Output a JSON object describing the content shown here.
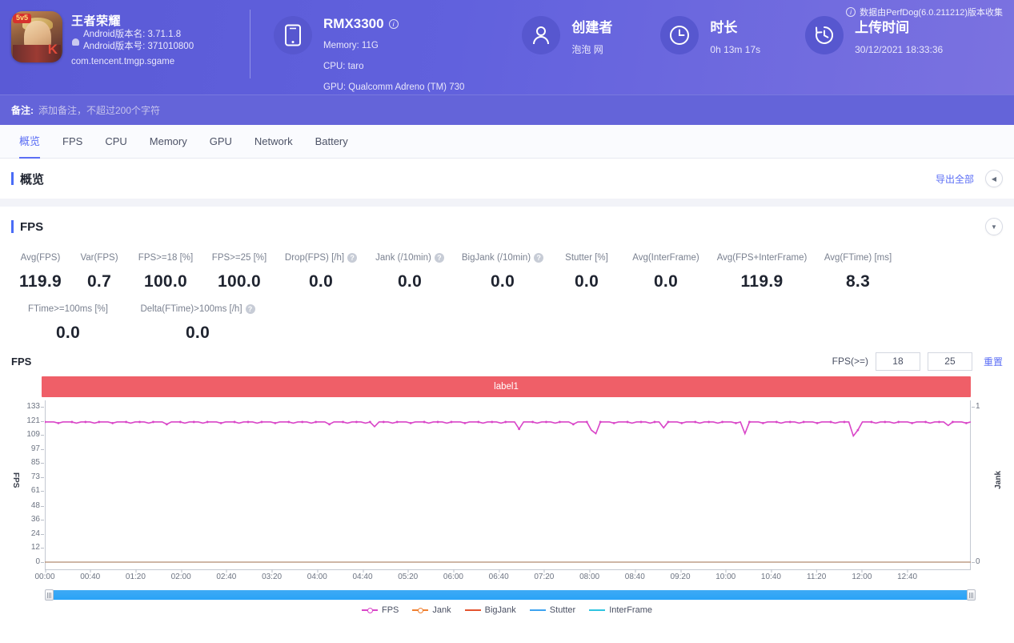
{
  "header": {
    "app": {
      "icon_name": "game-app-icon",
      "badge": "5v5",
      "name": "王者荣耀",
      "version_name_label": "Android版本名: 3.71.1.8",
      "version_code_label": "Android版本号: 371010800",
      "package": "com.tencent.tmgp.sgame"
    },
    "device": {
      "icon_name": "phone-icon",
      "model": "RMX3300",
      "memory": "Memory: 11G",
      "cpu": "CPU: taro",
      "gpu": "GPU: Qualcomm Adreno (TM) 730"
    },
    "creator": {
      "icon_name": "user-icon",
      "title": "创建者",
      "value": "泡泡 网"
    },
    "duration": {
      "icon_name": "clock-icon",
      "title": "时长",
      "value": "0h 13m 17s"
    },
    "upload": {
      "icon_name": "history-icon",
      "title": "上传时间",
      "value": "30/12/2021 18:33:36"
    },
    "perfdog_note": "数据由PerfDog(6.0.211212)版本收集"
  },
  "notebar": {
    "label": "备注:",
    "value": "",
    "placeholder": "添加备注，不超过200个字符"
  },
  "tabs": [
    {
      "label": "概览",
      "active": true
    },
    {
      "label": "FPS",
      "active": false
    },
    {
      "label": "CPU",
      "active": false
    },
    {
      "label": "Memory",
      "active": false
    },
    {
      "label": "GPU",
      "active": false
    },
    {
      "label": "Network",
      "active": false
    },
    {
      "label": "Battery",
      "active": false
    }
  ],
  "overview_panel": {
    "title": "概览",
    "export_label": "导出全部",
    "collapse_icon": "◀"
  },
  "fps_panel": {
    "title": "FPS",
    "expand_icon": "▼",
    "metrics_row1": [
      {
        "label": "Avg(FPS)",
        "value": "119.9",
        "help": false
      },
      {
        "label": "Var(FPS)",
        "value": "0.7",
        "help": false
      },
      {
        "label": "FPS>=18 [%]",
        "value": "100.0",
        "help": false
      },
      {
        "label": "FPS>=25 [%]",
        "value": "100.0",
        "help": false
      },
      {
        "label": "Drop(FPS) [/h]",
        "value": "0.0",
        "help": true
      },
      {
        "label": "Jank (/10min)",
        "value": "0.0",
        "help": true
      },
      {
        "label": "BigJank (/10min)",
        "value": "0.0",
        "help": true
      },
      {
        "label": "Stutter [%]",
        "value": "0.0",
        "help": false
      },
      {
        "label": "Avg(InterFrame)",
        "value": "0.0",
        "help": false
      },
      {
        "label": "Avg(FPS+InterFrame)",
        "value": "119.9",
        "help": false
      },
      {
        "label": "Avg(FTime) [ms]",
        "value": "8.3",
        "help": false
      }
    ],
    "metrics_row2": [
      {
        "label": "FTime>=100ms [%]",
        "value": "0.0",
        "help": false
      },
      {
        "label": "Delta(FTime)>100ms [/h]",
        "value": "0.0",
        "help": true
      }
    ],
    "chart_toolbar": {
      "chart_name": "FPS",
      "threshold_label": "FPS(>=)",
      "threshold_low": "18",
      "threshold_high": "25",
      "reset_label": "重置"
    },
    "label_banner": "label1",
    "label_banner_color": "#ef5f68"
  },
  "chart_data": {
    "type": "line",
    "title": "FPS",
    "xlabel": "",
    "ylabel": "FPS",
    "y2label": "Jank",
    "ylim": [
      0,
      133
    ],
    "y2lim": [
      0,
      1
    ],
    "grid": false,
    "legend_position": "bottom",
    "yticks": [
      133,
      121,
      109,
      97,
      85,
      73,
      61,
      48,
      36,
      24,
      12,
      0
    ],
    "y2ticks": [
      1,
      0
    ],
    "xticks": [
      "00:00",
      "00:40",
      "01:20",
      "02:00",
      "02:40",
      "03:20",
      "04:00",
      "04:40",
      "05:20",
      "06:00",
      "06:40",
      "07:20",
      "08:00",
      "08:40",
      "09:20",
      "10:00",
      "10:40",
      "11:20",
      "12:00",
      "12:40"
    ],
    "series": [
      {
        "name": "FPS",
        "color": "#d946c8",
        "values": [
          120,
          120,
          120,
          119,
          120,
          120,
          120,
          119,
          120,
          120,
          120,
          119,
          120,
          120,
          120,
          119,
          120,
          120,
          120,
          119,
          120,
          120,
          120,
          119,
          120,
          120,
          120,
          118,
          120,
          120,
          120,
          119,
          120,
          120,
          120,
          119,
          120,
          120,
          120,
          119,
          120,
          120,
          120,
          119,
          120,
          120,
          120,
          119,
          120,
          120,
          120,
          119,
          120,
          120,
          120,
          119,
          120,
          120,
          120,
          119,
          120,
          120,
          120,
          118,
          120,
          120,
          120,
          119,
          120,
          120,
          120,
          119,
          120,
          116,
          120,
          120,
          120,
          119,
          120,
          120,
          120,
          119,
          120,
          120,
          120,
          119,
          120,
          120,
          120,
          119,
          120,
          120,
          120,
          119,
          120,
          120,
          120,
          119,
          120,
          120,
          120,
          119,
          120,
          120,
          120,
          114,
          120,
          120,
          120,
          119,
          120,
          120,
          120,
          119,
          120,
          120,
          120,
          118,
          120,
          120,
          120,
          113,
          110,
          120,
          120,
          120,
          119,
          120,
          120,
          120,
          119,
          120,
          120,
          120,
          119,
          120,
          120,
          115,
          120,
          120,
          120,
          119,
          120,
          120,
          120,
          119,
          120,
          120,
          120,
          119,
          120,
          120,
          120,
          119,
          120,
          110,
          120,
          120,
          120,
          119,
          120,
          120,
          120,
          119,
          120,
          120,
          120,
          119,
          120,
          120,
          120,
          119,
          120,
          120,
          120,
          119,
          120,
          120,
          120,
          108,
          113,
          120,
          120,
          120,
          119,
          120,
          120,
          120,
          119,
          120,
          120,
          120,
          119,
          120,
          120,
          120,
          119,
          120,
          120,
          120,
          117,
          120,
          120,
          120,
          119,
          120
        ]
      },
      {
        "name": "Jank",
        "color": "#f08030",
        "values": []
      },
      {
        "name": "BigJank",
        "color": "#e4532f",
        "values": []
      },
      {
        "name": "Stutter",
        "color": "#3da3f0",
        "values": []
      },
      {
        "name": "InterFrame",
        "color": "#2fc4e0",
        "values": []
      }
    ],
    "legend": [
      {
        "name": "FPS",
        "color": "#d946c8",
        "marker": true
      },
      {
        "name": "Jank",
        "color": "#f08030",
        "marker": true
      },
      {
        "name": "BigJank",
        "color": "#e4532f",
        "marker": false
      },
      {
        "name": "Stutter",
        "color": "#3da3f0",
        "marker": false
      },
      {
        "name": "InterFrame",
        "color": "#2fc4e0",
        "marker": false
      }
    ]
  }
}
